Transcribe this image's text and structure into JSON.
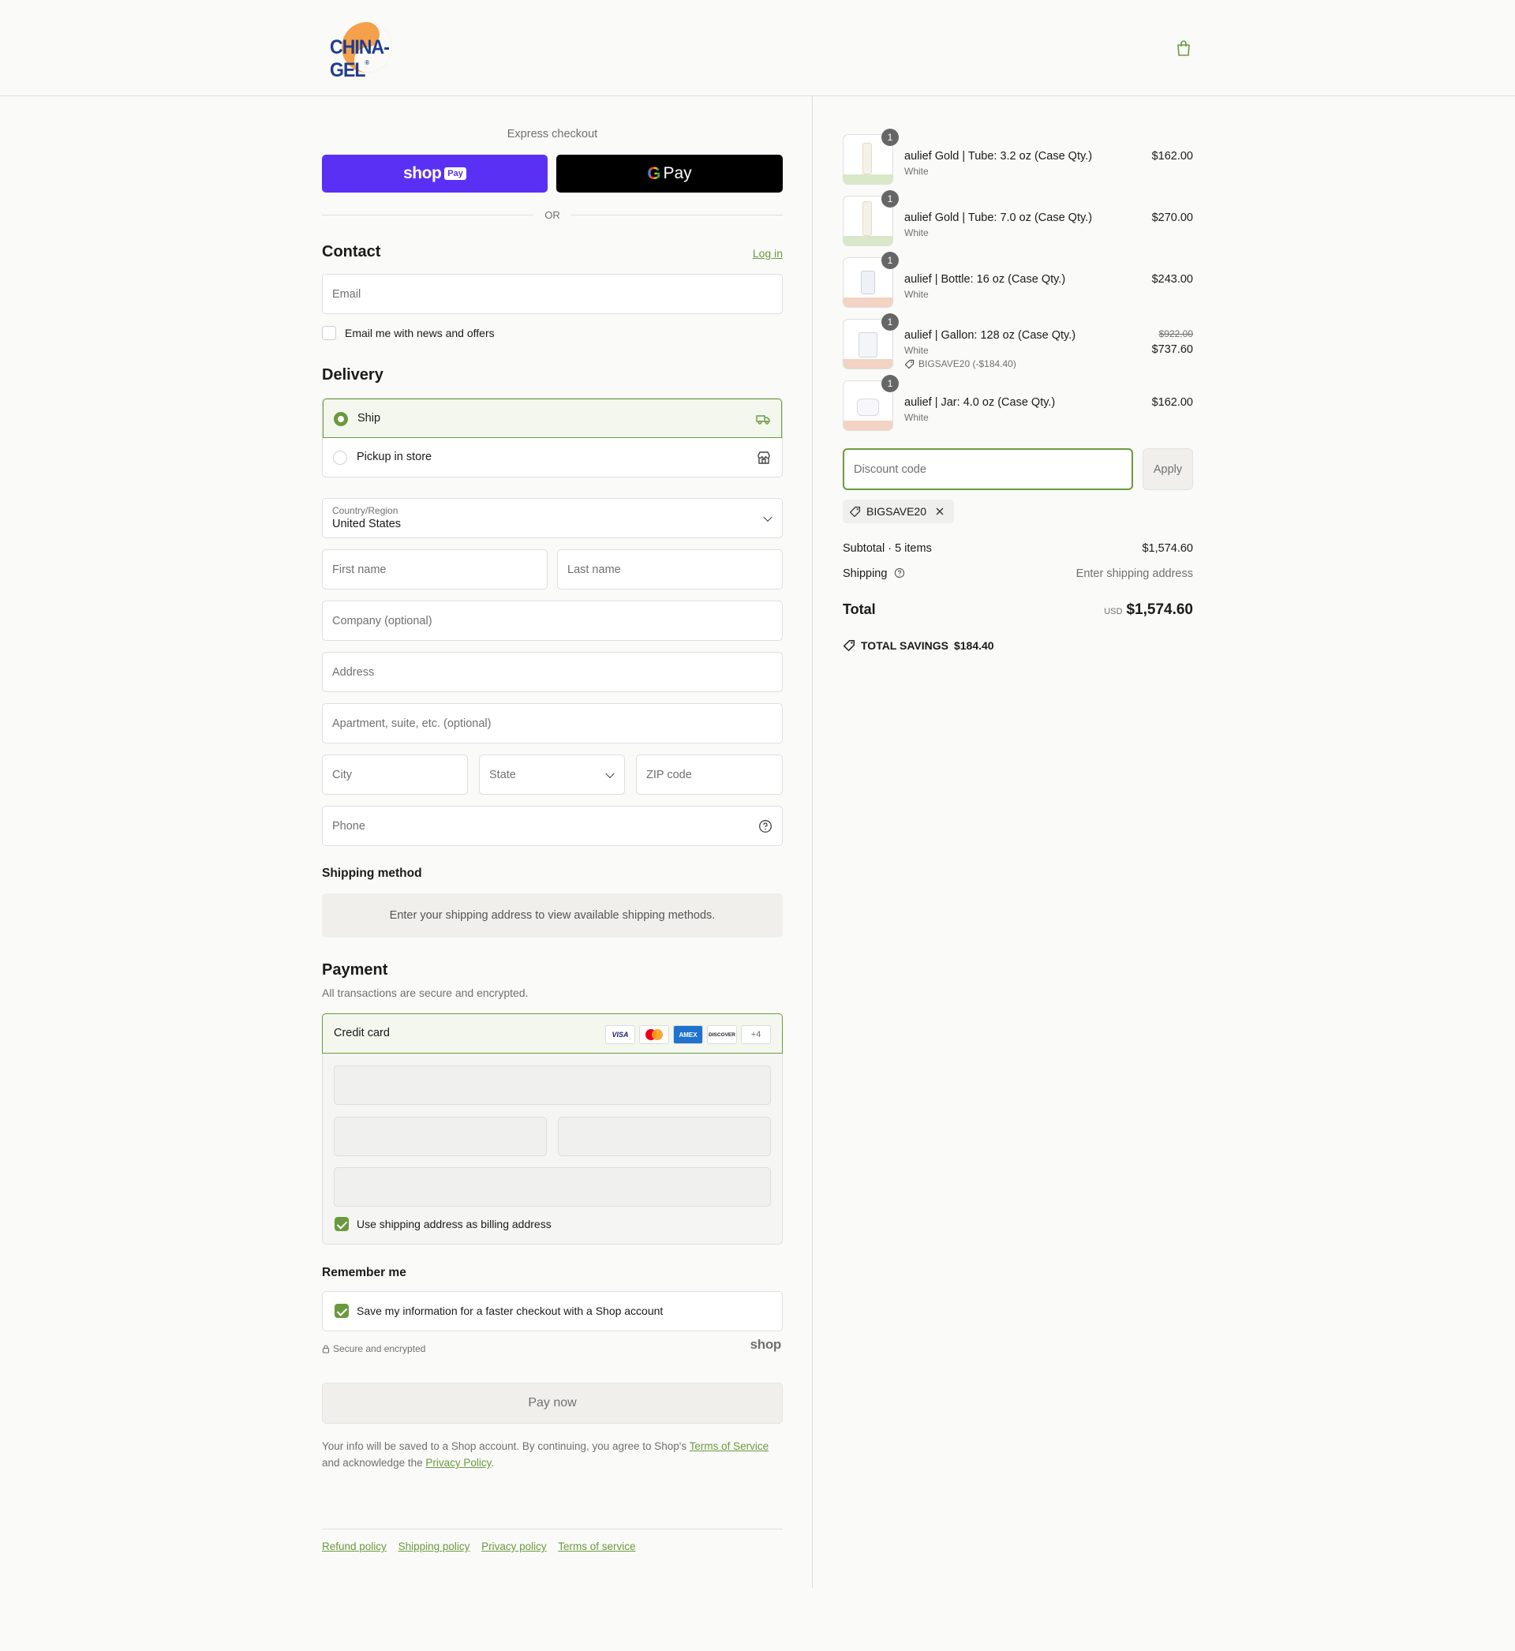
{
  "header": {
    "logo_text": "CHINA-GEL",
    "logo_reg": "®"
  },
  "express": {
    "title": "Express checkout",
    "shoppay_shop": "shop",
    "shoppay_pay": "Pay",
    "gpay_g": "G",
    "gpay_pay": "Pay",
    "or": "OR"
  },
  "contact": {
    "title": "Contact",
    "login": "Log in",
    "email_placeholder": "Email",
    "newsletter": "Email me with news and offers"
  },
  "delivery": {
    "title": "Delivery",
    "ship": "Ship",
    "pickup": "Pickup in store",
    "country_label": "Country/Region",
    "country_value": "United States",
    "first_name": "First name",
    "last_name": "Last name",
    "company": "Company (optional)",
    "address": "Address",
    "apartment": "Apartment, suite, etc. (optional)",
    "city": "City",
    "state": "State",
    "zip": "ZIP code",
    "phone": "Phone"
  },
  "shipping_method": {
    "title": "Shipping method",
    "notice": "Enter your shipping address to view available shipping methods."
  },
  "payment": {
    "title": "Payment",
    "subtitle": "All transactions are secure and encrypted.",
    "credit_card": "Credit card",
    "cards": [
      "VISA",
      "",
      "AMEX",
      "DISCOVER"
    ],
    "more_cards": "+4",
    "billing_same": "Use shipping address as billing address"
  },
  "remember": {
    "title": "Remember me",
    "save_info": "Save my information for a faster checkout with a Shop account",
    "secure": "Secure and encrypted",
    "shop_logo": "shop"
  },
  "pay_now": "Pay now",
  "legal": {
    "text_before": "Your info will be saved to a Shop account. By continuing, you agree to Shop's ",
    "terms": "Terms of Service",
    "text_mid": " and acknowledge the ",
    "privacy": "Privacy Policy",
    "text_end": "."
  },
  "footer": {
    "links": [
      "Refund policy",
      "Shipping policy",
      "Privacy policy",
      "Terms of service"
    ]
  },
  "summary": {
    "items": [
      {
        "name": "aulief Gold | Tube: 3.2 oz (Case Qty.)",
        "variant": "White",
        "price": "$162.00",
        "qty": "1"
      },
      {
        "name": "aulief Gold | Tube: 7.0 oz (Case Qty.)",
        "variant": "White",
        "price": "$270.00",
        "qty": "1"
      },
      {
        "name": "aulief | Bottle: 16 oz (Case Qty.)",
        "variant": "White",
        "price": "$243.00",
        "qty": "1"
      },
      {
        "name": "aulief | Gallon: 128 oz (Case Qty.)",
        "variant": "White",
        "price": "$737.60",
        "old_price": "$922.00",
        "discount": "BIGSAVE20 (-$184.40)",
        "qty": "1"
      },
      {
        "name": "aulief | Jar: 4.0 oz (Case Qty.)",
        "variant": "White",
        "price": "$162.00",
        "qty": "1"
      }
    ],
    "discount_placeholder": "Discount code",
    "apply": "Apply",
    "applied_code": "BIGSAVE20",
    "subtotal_label": "Subtotal · 5 items",
    "subtotal_value": "$1,574.60",
    "shipping_label": "Shipping",
    "shipping_value": "Enter shipping address",
    "total_label": "Total",
    "currency": "USD",
    "total_value": "$1,574.60",
    "savings_label": "TOTAL SAVINGS",
    "savings_value": "$184.40"
  },
  "colors": {
    "accent": "#6b9a3e",
    "shoppay": "#5a31f4",
    "gpay": "#000000",
    "logo_blue": "#1e3d8f",
    "logo_orange": "#f5a04a"
  }
}
